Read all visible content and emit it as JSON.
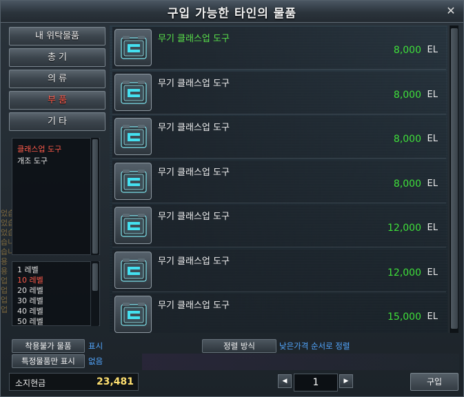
{
  "window": {
    "title": "구입 가능한 타인의 물품",
    "close": "✕"
  },
  "categories": [
    {
      "label": "내 위탁물품",
      "active": false
    },
    {
      "label": "총 기",
      "active": false
    },
    {
      "label": "의 류",
      "active": false
    },
    {
      "label": "부 품",
      "active": true
    },
    {
      "label": "기 타",
      "active": false
    }
  ],
  "subcategories": [
    {
      "label": "클래스업 도구",
      "active": true
    },
    {
      "label": "개조 도구",
      "active": false
    }
  ],
  "levels": [
    {
      "label": "1 레벨",
      "active": false
    },
    {
      "label": "10 레벨",
      "active": true
    },
    {
      "label": "20 레벨",
      "active": false
    },
    {
      "label": "30 레벨",
      "active": false
    },
    {
      "label": "40 레벨",
      "active": false
    },
    {
      "label": "50 레벨",
      "active": false
    }
  ],
  "chat_bleed": [
    "었습니다",
    "었습니다",
    "었습니다",
    "습니다",
    "습니다",
    "용",
    "용",
    "업",
    "업",
    "업",
    "업"
  ],
  "items": [
    {
      "name": "무기 클래스업 도구",
      "price": "8,000",
      "unit": "EL",
      "highlight": true
    },
    {
      "name": "무기 클래스업 도구",
      "price": "8,000",
      "unit": "EL",
      "highlight": false
    },
    {
      "name": "무기 클래스업 도구",
      "price": "8,000",
      "unit": "EL",
      "highlight": false
    },
    {
      "name": "무기 클래스업 도구",
      "price": "8,000",
      "unit": "EL",
      "highlight": false
    },
    {
      "name": "무기 클래스업 도구",
      "price": "12,000",
      "unit": "EL",
      "highlight": false
    },
    {
      "name": "무기 클래스업 도구",
      "price": "12,000",
      "unit": "EL",
      "highlight": false
    },
    {
      "name": "무기 클래스업 도구",
      "price": "15,000",
      "unit": "EL",
      "highlight": false
    }
  ],
  "options": {
    "unwearable_label": "착용불가 물품",
    "unwearable_value": "표시",
    "specific_label": "특정물품만 표시",
    "specific_value": "없음",
    "sort_label": "정렬 방식",
    "sort_value": "낮은가격 순서로 정렬"
  },
  "footer": {
    "money_label": "소지현금",
    "money_value": "23,481",
    "prev": "◀",
    "page": "1",
    "next": "▶",
    "buy_label": "구입"
  },
  "colors": {
    "price_green": "#3fe03a",
    "highlight_green": "#59e04a",
    "active_red": "#ff5a4a",
    "option_blue": "#53a7ff",
    "money_yellow": "#ffe070"
  }
}
